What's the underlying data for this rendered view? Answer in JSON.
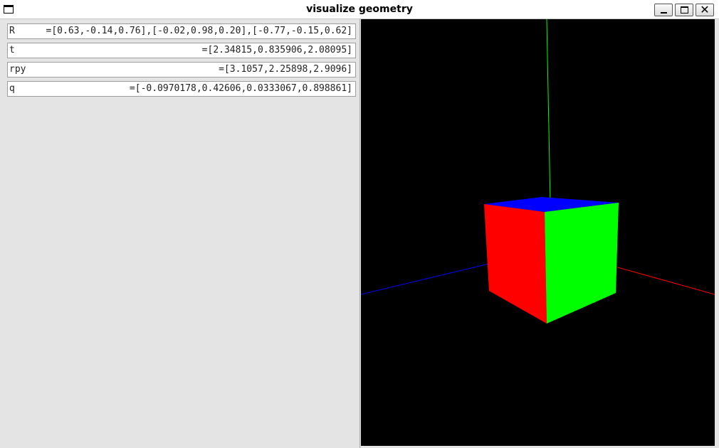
{
  "window": {
    "title": "visualize geometry",
    "icon": "window-menu-icon",
    "controls": [
      "minimize-icon",
      "maximize-icon",
      "close-icon"
    ],
    "close_glyph": "✕"
  },
  "fields": [
    {
      "label": "R",
      "value": "=[0.63,-0.14,0.76],[-0.02,0.98,0.20],[-0.77,-0.15,0.62]"
    },
    {
      "label": "t",
      "value": "=[2.34815,0.835906,2.08095]"
    },
    {
      "label": "rpy",
      "value": "=[3.1057,2.25898,2.9096]"
    },
    {
      "label": "q",
      "value": "=[-0.0970178,0.42606,0.0333067,0.898861]"
    }
  ],
  "viewport": {
    "background": "#000000",
    "cube_faces": {
      "top": "#0000ff",
      "left": "#ff0000",
      "right": "#00ff00"
    },
    "axis_colors": {
      "x": "#ff0000",
      "y": "#00ff00",
      "z": "#0000ff"
    }
  }
}
